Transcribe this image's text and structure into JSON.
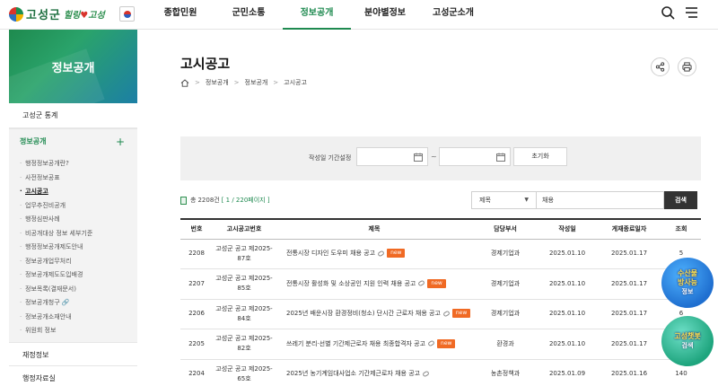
{
  "header": {
    "logo_text": "고성군",
    "slogan_a": "힐링",
    "slogan_heart": "♥",
    "slogan_b": "고성",
    "gnb": [
      "종합민원",
      "군민소통",
      "정보공개",
      "분야별정보",
      "고성군소개"
    ],
    "active_gnb": "정보공개"
  },
  "sidebar": {
    "banner_title": "정보공개",
    "top_item": "고성군 통계",
    "group_label": "정보공개",
    "group_toggle": "+",
    "sub_items": [
      "행정정보공개란?",
      "사전정보공표",
      "고시공고",
      "업무추진비공개",
      "행정심판사례",
      "비공개대상 정보 세부기준",
      "행정정보공개제도안내",
      "정보공개업무처리",
      "정보공개제도도입배경",
      "정보목록(결재문서)",
      "정보공개청구",
      "정보공개소재안내",
      "위원회 정보"
    ],
    "active_sub": "고시공고",
    "external_marker": "🔗",
    "bottom_items": [
      "재정정보",
      "행정자료실"
    ]
  },
  "page": {
    "title": "고시공고",
    "breadcrumb": [
      "정보공개",
      "정보공개",
      "고시공고"
    ]
  },
  "filter": {
    "label": "작성일 기간설정",
    "start_date": "",
    "end_date": "",
    "separator": "~",
    "reset_label": "초기화"
  },
  "list": {
    "total_prefix": "총",
    "total": "2208건",
    "page_info": "[ 1 / 220페이지 ]",
    "search_field": "제목",
    "search_query": "채용",
    "search_button": "검색",
    "columns": [
      "번호",
      "고시공고번호",
      "제목",
      "담당부서",
      "작성일",
      "게재종료일자",
      "조회"
    ],
    "rows": [
      {
        "no": "2208",
        "code": "고성군 공고 제2025-87호",
        "title": "전통시장 디자인 도우미 채용 공고",
        "new": true,
        "dept": "경제기업과",
        "date": "2025.01.10",
        "end": "2025.01.17",
        "views": "5"
      },
      {
        "no": "2207",
        "code": "고성군 공고 제2025-85호",
        "title": "전통시장 활성화 및 소상공인 지원 인력 채용 공고",
        "new": true,
        "dept": "경제기업과",
        "date": "2025.01.10",
        "end": "2025.01.17",
        "views": "6"
      },
      {
        "no": "2206",
        "code": "고성군 공고 제2025-84호",
        "title": "2025년 배운시장 환경정비(청소) 단시간 근로자 채용 공고",
        "new": true,
        "dept": "경제기업과",
        "date": "2025.01.10",
        "end": "2025.01.17",
        "views": "6"
      },
      {
        "no": "2205",
        "code": "고성군 공고 제2025-82호",
        "title": "쓰레기 분리·선별 기간제근로자 채용 최종합격자 공고",
        "new": true,
        "dept": "환경과",
        "date": "2025.01.10",
        "end": "2025.01.17",
        "views": ""
      },
      {
        "no": "2204",
        "code": "고성군 공고 제2025-65호",
        "title": "2025년 농기계임대사업소 기간제근로자 채용 공고",
        "new": false,
        "dept": "농촌정책과",
        "date": "2025.01.09",
        "end": "2025.01.16",
        "views": "140"
      }
    ],
    "new_label": "new"
  },
  "floating": {
    "widget1_line1": "수산물",
    "widget1_line2": "방사능",
    "widget1_sub": "정보",
    "widget2_line1": "고성챗봇",
    "widget2_sub": "검색"
  },
  "colors": {
    "accent": "#1f8a50",
    "new_badge": "#f06a24",
    "search_button": "#333333"
  }
}
